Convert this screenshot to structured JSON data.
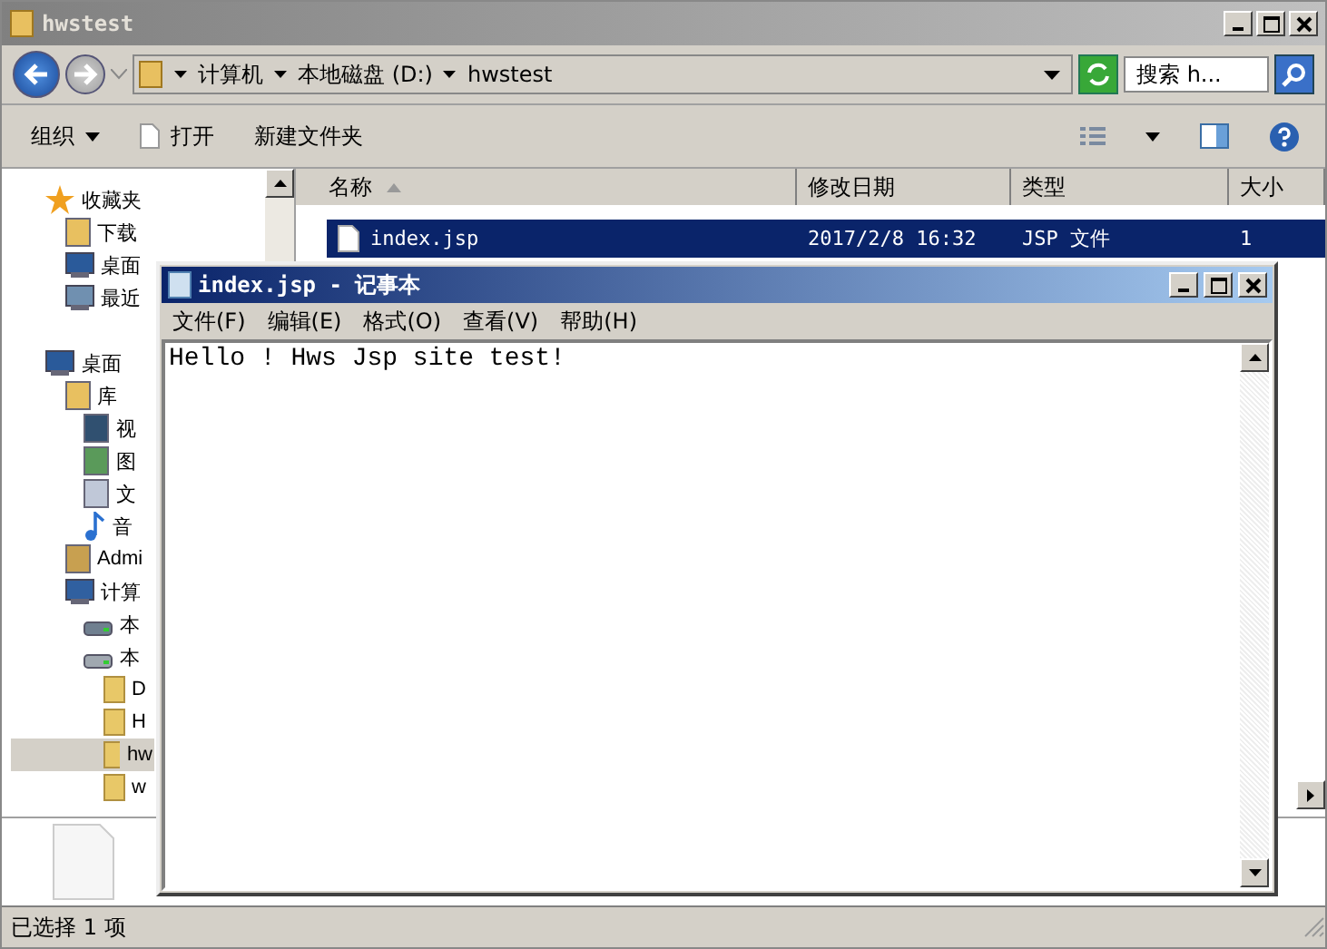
{
  "explorer": {
    "title": "hwstest",
    "breadcrumb": [
      "计算机",
      "本地磁盘 (D:)",
      "hwstest"
    ],
    "search": {
      "placeholder": "搜索 h..."
    },
    "toolbar": [
      {
        "label": "组织",
        "kind": "menu"
      },
      {
        "label": "打开",
        "kind": "open"
      },
      {
        "label": "新建文件夹",
        "kind": "plain"
      }
    ],
    "sidebar": {
      "items": [
        {
          "label": "收藏夹",
          "kind": "star",
          "selected": false,
          "children": [
            {
              "label": "下载",
              "kind": "download",
              "selected": false
            },
            {
              "label": "桌面",
              "kind": "desktop",
              "selected": false
            },
            {
              "label": "最近",
              "kind": "recent",
              "selected": false
            }
          ]
        },
        {
          "label": "桌面",
          "kind": "desktop",
          "selected": false,
          "children": [
            {
              "label": "库",
              "kind": "library",
              "selected": false,
              "children": [
                {
                  "label": "视",
                  "kind": "video",
                  "selected": false
                },
                {
                  "label": "图",
                  "kind": "image",
                  "selected": false
                },
                {
                  "label": "文",
                  "kind": "doc",
                  "selected": false
                },
                {
                  "label": "音",
                  "kind": "music",
                  "selected": false
                }
              ]
            },
            {
              "label": "Admi",
              "kind": "user",
              "selected": false
            },
            {
              "label": "计算",
              "kind": "computer",
              "selected": false,
              "children": [
                {
                  "label": "本",
                  "kind": "sysdrive",
                  "selected": false
                },
                {
                  "label": "本",
                  "kind": "drive",
                  "selected": false,
                  "children": [
                    {
                      "label": "D",
                      "kind": "folder",
                      "selected": false
                    },
                    {
                      "label": "H",
                      "kind": "folder",
                      "selected": false
                    },
                    {
                      "label": "hw",
                      "kind": "folder",
                      "selected": true
                    },
                    {
                      "label": "w",
                      "kind": "folder",
                      "selected": false
                    }
                  ]
                }
              ]
            }
          ]
        }
      ]
    },
    "table": {
      "columns": [
        {
          "label": "名称",
          "sorted": true
        },
        {
          "label": "修改日期",
          "sorted": false
        },
        {
          "label": "类型",
          "sorted": false
        },
        {
          "label": "大小",
          "sorted": false
        }
      ],
      "rows": [
        {
          "name": "index.jsp",
          "date": "2017/2/8 16:32",
          "type": "JSP 文件",
          "size": "1",
          "selected": true
        }
      ]
    },
    "status_bar": "已选择 1 项"
  },
  "notepad": {
    "title": "index.jsp - 记事本",
    "menu": [
      "文件(F)",
      "编辑(E)",
      "格式(O)",
      "查看(V)",
      "帮助(H)"
    ],
    "text": "Hello ! Hws Jsp site test!"
  }
}
